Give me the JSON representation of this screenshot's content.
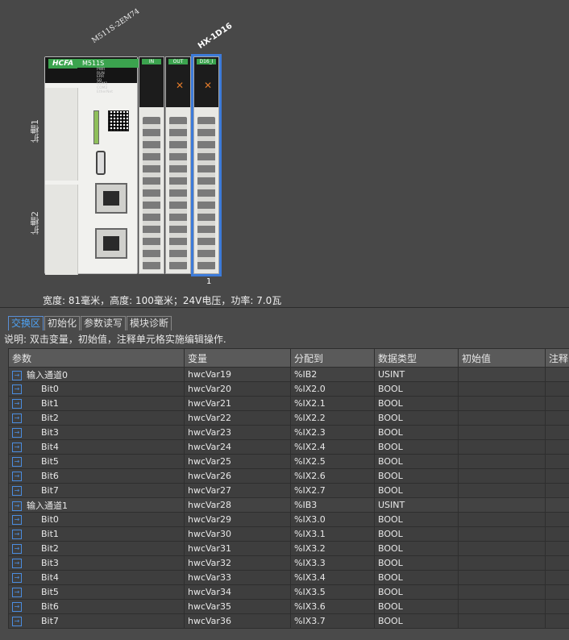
{
  "canvas": {
    "main_module_label": "M511S-2EM74",
    "io_module_label": "HX-1D16",
    "slot1_label": "扩槽1",
    "slot2_label": "扩槽2",
    "brand": "HCFA",
    "model": "M511S",
    "leds": [
      "PWR",
      "RUN",
      "ERR",
      "SD",
      "COM1",
      "COM2",
      "EtherNet",
      "EtherCAT"
    ],
    "port_labels": [
      "SD",
      "USB",
      "EtherNet",
      "EtherCAT"
    ],
    "modules": [
      {
        "tag": "IN"
      },
      {
        "tag": "OUT"
      },
      {
        "tag": "D16_I"
      }
    ],
    "selected_index": "1",
    "dimensions_text": "宽度: 81毫米，高度: 100毫米；24V电压，功率: 7.0瓦"
  },
  "tabs": [
    {
      "label": "交换区",
      "active": true
    },
    {
      "label": "初始化",
      "active": false
    },
    {
      "label": "参数读写",
      "active": false
    },
    {
      "label": "模块诊断",
      "active": false
    }
  ],
  "note": "说明: 双击变量，初始值，注释单元格实施编辑操作.",
  "table": {
    "headers": [
      "参数",
      "变量",
      "分配到",
      "数据类型",
      "初始值",
      "注释"
    ],
    "rows": [
      {
        "param": "输入通道0",
        "var": "hwcVar19",
        "addr": "%IB2",
        "type": "USINT",
        "group": true
      },
      {
        "param": "Bit0",
        "var": "hwcVar20",
        "addr": "%IX2.0",
        "type": "BOOL"
      },
      {
        "param": "Bit1",
        "var": "hwcVar21",
        "addr": "%IX2.1",
        "type": "BOOL"
      },
      {
        "param": "Bit2",
        "var": "hwcVar22",
        "addr": "%IX2.2",
        "type": "BOOL"
      },
      {
        "param": "Bit3",
        "var": "hwcVar23",
        "addr": "%IX2.3",
        "type": "BOOL"
      },
      {
        "param": "Bit4",
        "var": "hwcVar24",
        "addr": "%IX2.4",
        "type": "BOOL"
      },
      {
        "param": "Bit5",
        "var": "hwcVar25",
        "addr": "%IX2.5",
        "type": "BOOL"
      },
      {
        "param": "Bit6",
        "var": "hwcVar26",
        "addr": "%IX2.6",
        "type": "BOOL"
      },
      {
        "param": "Bit7",
        "var": "hwcVar27",
        "addr": "%IX2.7",
        "type": "BOOL"
      },
      {
        "param": "输入通道1",
        "var": "hwcVar28",
        "addr": "%IB3",
        "type": "USINT",
        "group": true
      },
      {
        "param": "Bit0",
        "var": "hwcVar29",
        "addr": "%IX3.0",
        "type": "BOOL"
      },
      {
        "param": "Bit1",
        "var": "hwcVar30",
        "addr": "%IX3.1",
        "type": "BOOL"
      },
      {
        "param": "Bit2",
        "var": "hwcVar31",
        "addr": "%IX3.2",
        "type": "BOOL"
      },
      {
        "param": "Bit3",
        "var": "hwcVar32",
        "addr": "%IX3.3",
        "type": "BOOL"
      },
      {
        "param": "Bit4",
        "var": "hwcVar33",
        "addr": "%IX3.4",
        "type": "BOOL"
      },
      {
        "param": "Bit5",
        "var": "hwcVar34",
        "addr": "%IX3.5",
        "type": "BOOL"
      },
      {
        "param": "Bit6",
        "var": "hwcVar35",
        "addr": "%IX3.6",
        "type": "BOOL"
      },
      {
        "param": "Bit7",
        "var": "hwcVar36",
        "addr": "%IX3.7",
        "type": "BOOL"
      }
    ]
  },
  "colors": {
    "accent": "#4ea3f5",
    "selection": "#3d7bd9",
    "module_green": "#3ba34e"
  }
}
